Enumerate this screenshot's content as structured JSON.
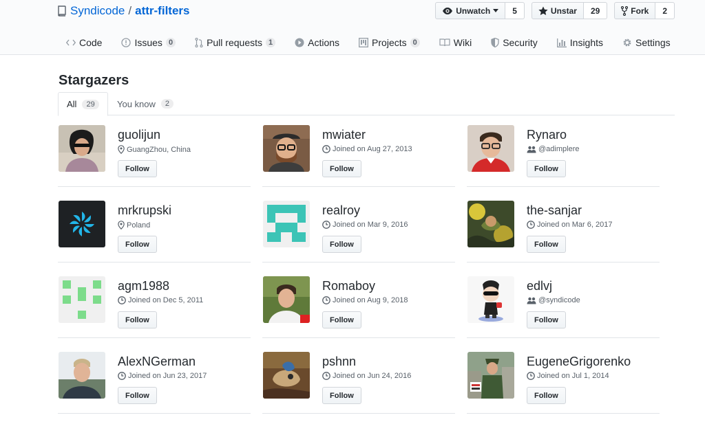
{
  "repo": {
    "owner": "Syndicode",
    "separator": "/",
    "name": "attr-filters"
  },
  "actions": [
    {
      "icon": "eye-icon",
      "label": "Unwatch",
      "count": "5"
    },
    {
      "icon": "star-icon",
      "label": "Unstar",
      "count": "29"
    },
    {
      "icon": "fork-icon",
      "label": "Fork",
      "count": "2"
    }
  ],
  "tabs": [
    {
      "icon": "code-icon",
      "label": "Code",
      "count": ""
    },
    {
      "icon": "issue-icon",
      "label": "Issues",
      "count": "0"
    },
    {
      "icon": "pull-request-icon",
      "label": "Pull requests",
      "count": "1"
    },
    {
      "icon": "play-icon",
      "label": "Actions",
      "count": ""
    },
    {
      "icon": "project-icon",
      "label": "Projects",
      "count": "0"
    },
    {
      "icon": "book-icon",
      "label": "Wiki",
      "count": ""
    },
    {
      "icon": "shield-icon",
      "label": "Security",
      "count": ""
    },
    {
      "icon": "graph-icon",
      "label": "Insights",
      "count": ""
    },
    {
      "icon": "gear-icon",
      "label": "Settings",
      "count": ""
    }
  ],
  "page_title": "Stargazers",
  "subtabs": {
    "all": {
      "label": "All",
      "count": "29"
    },
    "you_know": {
      "label": "You know",
      "count": "2"
    }
  },
  "follow_label": "Follow",
  "users": [
    {
      "username": "guolijun",
      "meta_icon": "location-icon",
      "meta": "GuangZhou, China"
    },
    {
      "username": "mwiater",
      "meta_icon": "clock-icon",
      "meta": "Joined on Aug 27, 2013"
    },
    {
      "username": "Rynaro",
      "meta_icon": "organization-icon",
      "meta": "@adimplere"
    },
    {
      "username": "mrkrupski",
      "meta_icon": "location-icon",
      "meta": "Poland"
    },
    {
      "username": "realroy",
      "meta_icon": "clock-icon",
      "meta": "Joined on Mar 9, 2016"
    },
    {
      "username": "the-sanjar",
      "meta_icon": "clock-icon",
      "meta": "Joined on Mar 6, 2017"
    },
    {
      "username": "agm1988",
      "meta_icon": "clock-icon",
      "meta": "Joined on Dec 5, 2011"
    },
    {
      "username": "Romaboy",
      "meta_icon": "clock-icon",
      "meta": "Joined on Aug 9, 2018"
    },
    {
      "username": "edlvj",
      "meta_icon": "organization-icon",
      "meta": "@syndicode"
    },
    {
      "username": "AlexNGerman",
      "meta_icon": "clock-icon",
      "meta": "Joined on Jun 23, 2017"
    },
    {
      "username": "pshnn",
      "meta_icon": "clock-icon",
      "meta": "Joined on Jun 24, 2016"
    },
    {
      "username": "EugeneGrigorenko",
      "meta_icon": "clock-icon",
      "meta": "Joined on Jul 1, 2014"
    }
  ],
  "colors": {
    "link": "#0366d6",
    "text": "#24292e",
    "muted": "#586069",
    "border": "#e1e4e8",
    "header_bg": "#fafbfc"
  }
}
